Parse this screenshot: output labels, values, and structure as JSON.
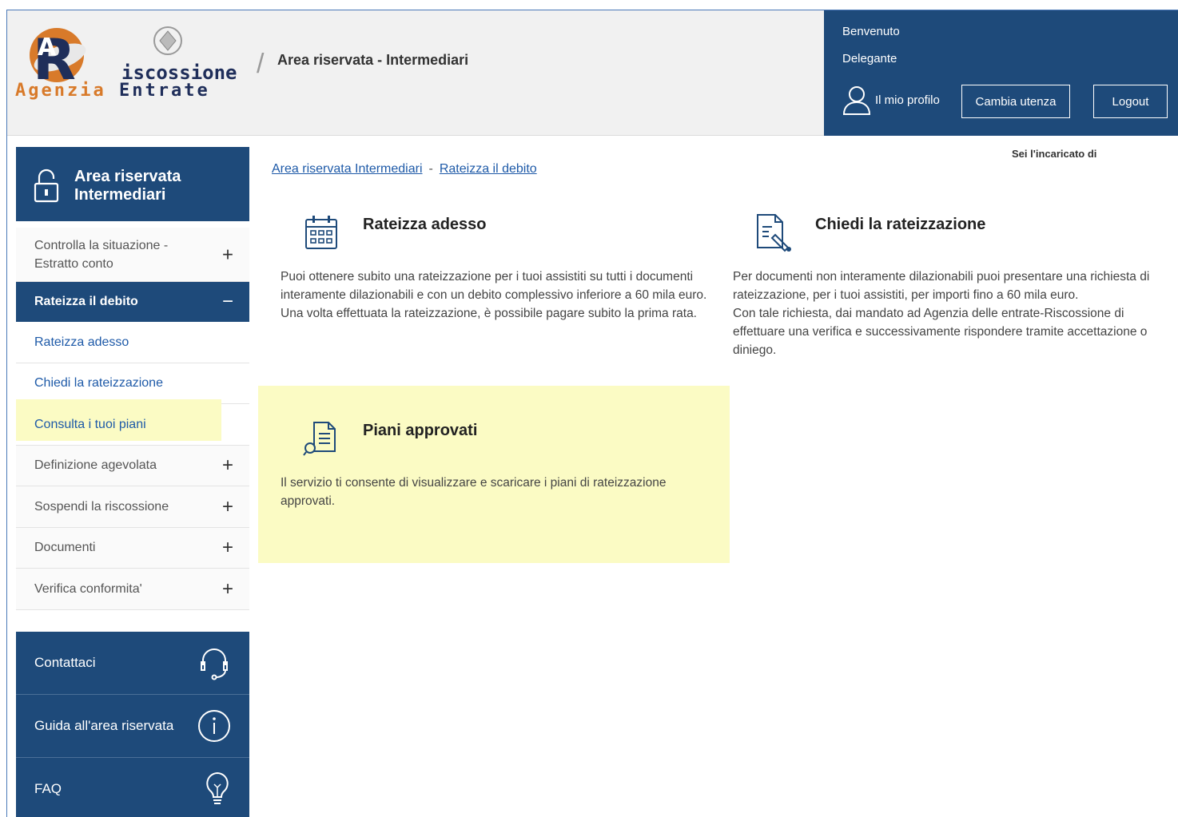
{
  "header": {
    "logo_line1": "iscossione",
    "logo_line2a": "Agenzia",
    "logo_line2b": "Entrate",
    "title": "Area riservata - Intermediari",
    "welcome": "Benvenuto",
    "role": "Delegante",
    "profile_label": "Il mio profilo",
    "cambia_label": "Cambia utenza",
    "logout_label": "Logout",
    "incaricato": "Sei l'incaricato di"
  },
  "sidebar": {
    "head_line1": "Area riservata",
    "head_line2": "Intermediari",
    "items": [
      {
        "label_line1": "Controlla la situazione -",
        "label_line2": "Estratto conto",
        "sign": "+"
      },
      {
        "label": "Rateizza il debito",
        "sign": "−"
      },
      {
        "label": "Rateizza adesso"
      },
      {
        "label": "Chiedi la rateizzazione"
      },
      {
        "label": "Consulta i tuoi piani"
      },
      {
        "label": "Definizione agevolata",
        "sign": "+"
      },
      {
        "label": "Sospendi la riscossione",
        "sign": "+"
      },
      {
        "label": "Documenti",
        "sign": "+"
      },
      {
        "label": "Verifica conformita'",
        "sign": "+"
      }
    ],
    "footer": [
      {
        "label": "Contattaci",
        "icon": "headset-icon"
      },
      {
        "label": "Guida all'area riservata",
        "icon": "info-icon"
      },
      {
        "label": "FAQ",
        "icon": "lightbulb-icon"
      }
    ]
  },
  "breadcrumb": {
    "item1": "Area riservata Intermediari",
    "separator": "-",
    "item2": "Rateizza il debito"
  },
  "cards": {
    "rateizza": {
      "title": "Rateizza adesso",
      "desc1": "Puoi ottenere subito una rateizzazione per i tuoi assistiti su tutti i documenti interamente dilazionabili e con un debito complessivo inferiore a 60 mila euro.",
      "desc2": "Una volta effettuata la rateizzazione, è possibile pagare subito la prima rata."
    },
    "chiedi": {
      "title": "Chiedi la rateizzazione",
      "desc1": "Per documenti non interamente dilazionabili puoi presentare una richiesta di rateizzazione, per i tuoi assistiti, per importi fino a 60 mila euro.",
      "desc2": "Con tale richiesta, dai mandato ad Agenzia delle entrate-Riscossione di effettuare una verifica e successivamente rispondere tramite accettazione o diniego."
    },
    "piani": {
      "title": "Piani approvati",
      "desc": "Il servizio ti consente di visualizzare e scaricare i piani di rateizzazione approvati."
    }
  },
  "colors": {
    "brand_blue": "#1e4a7a",
    "highlight_yellow": "#fbfbc4",
    "link_blue": "#1e5aa8",
    "logo_orange": "#d87a2a"
  }
}
